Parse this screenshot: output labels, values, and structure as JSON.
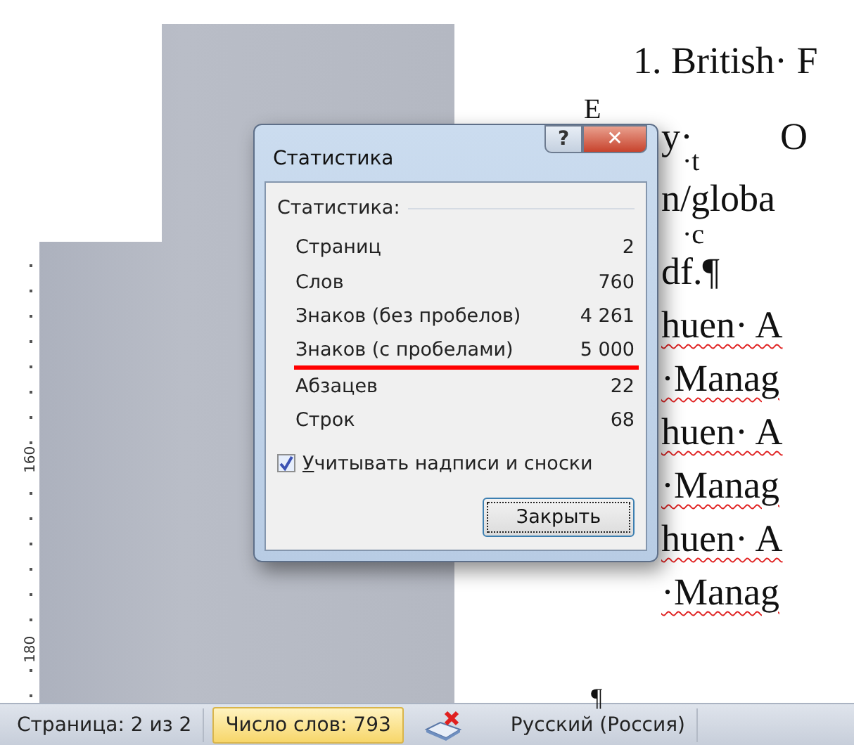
{
  "ruler": {
    "labels": [
      "160",
      "180"
    ]
  },
  "document": {
    "lines": [
      {
        "kind": "heading",
        "text": "1. British· F",
        "spelling_error": false
      },
      {
        "kind": "peek",
        "text": "Е"
      },
      {
        "kind": "split",
        "text": "y·",
        "tail": "O"
      },
      {
        "kind": "fragment",
        "text": "·t",
        "spelling_error": false
      },
      {
        "kind": "body",
        "text": "n/globa",
        "spelling_error": false
      },
      {
        "kind": "fragment",
        "text": "·c",
        "spelling_error": false
      },
      {
        "kind": "body",
        "text": "df.¶",
        "spelling_error": false
      },
      {
        "kind": "body",
        "text": "huen· A",
        "spelling_error": true
      },
      {
        "kind": "body",
        "text": "·Manag",
        "spelling_error": true
      },
      {
        "kind": "body",
        "text": "huen· A",
        "spelling_error": true
      },
      {
        "kind": "body",
        "text": "·Manag",
        "spelling_error": true
      },
      {
        "kind": "body",
        "text": "huen· A",
        "spelling_error": true
      },
      {
        "kind": "body",
        "text": "·Manag",
        "spelling_error": true
      }
    ],
    "end_mark": "¶"
  },
  "dialog": {
    "title": "Статистика",
    "help_button": "?",
    "close_button": "✕",
    "group_label": "Статистика:",
    "rows": [
      {
        "label": "Страниц",
        "value": "2",
        "highlighted": false
      },
      {
        "label": "Слов",
        "value": "760",
        "highlighted": false
      },
      {
        "label": "Знаков (без пробелов)",
        "value": "4 261",
        "highlighted": false
      },
      {
        "label": "Знаков (с пробелами)",
        "value": "5 000",
        "highlighted": true
      },
      {
        "label": "Абзацев",
        "value": "22",
        "highlighted": false
      },
      {
        "label": "Строк",
        "value": "68",
        "highlighted": false
      }
    ],
    "checkbox": {
      "access_key": "У",
      "label_rest": "читывать надписи и сноски",
      "checked": true
    },
    "close_label": "Закрыть"
  },
  "status_bar": {
    "items": [
      {
        "kind": "text",
        "text": "Страница: 2 из 2",
        "selected": false
      },
      {
        "kind": "text",
        "text": "Число слов: 793",
        "selected": true
      },
      {
        "kind": "icon",
        "selected": false
      },
      {
        "kind": "text",
        "text": "Русский (Россия)",
        "selected": false
      }
    ]
  }
}
